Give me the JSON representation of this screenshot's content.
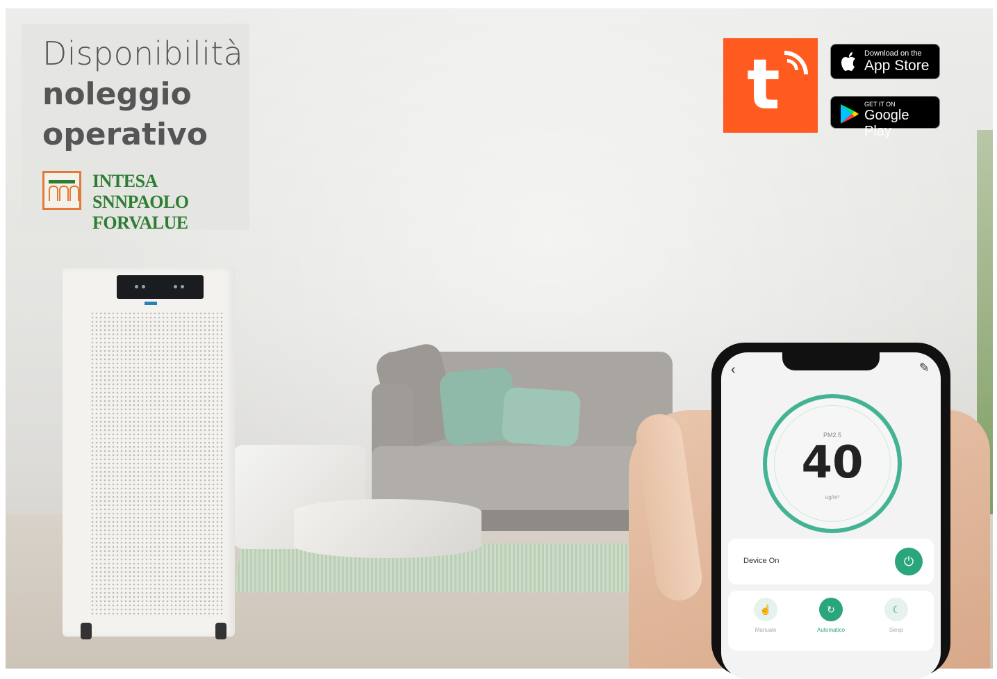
{
  "promo": {
    "line1": "Disponibilità",
    "line2": "noleggio",
    "line3": "operativo"
  },
  "bank": {
    "name_line1": "INTESA SNNPAOLO",
    "name_line2": "FORVALUE"
  },
  "tuya": {
    "glyph": "t"
  },
  "stores": {
    "apple_small": "Download on the",
    "apple_big": "App Store",
    "google_small": "GET IT ON",
    "google_big": "Google Play"
  },
  "app": {
    "pm_label": "PM2.5",
    "pm_value": "40",
    "pm_unit": "ug/m³",
    "device_label": "Device On",
    "modes": [
      {
        "label": "Manuale"
      },
      {
        "label": "Automatico"
      },
      {
        "label": "Sleep"
      }
    ]
  },
  "colors": {
    "accent_green": "#2aa57c",
    "tuya_orange": "#ff5a1f",
    "bank_green": "#2e7d32",
    "bank_orange": "#e07b39"
  }
}
